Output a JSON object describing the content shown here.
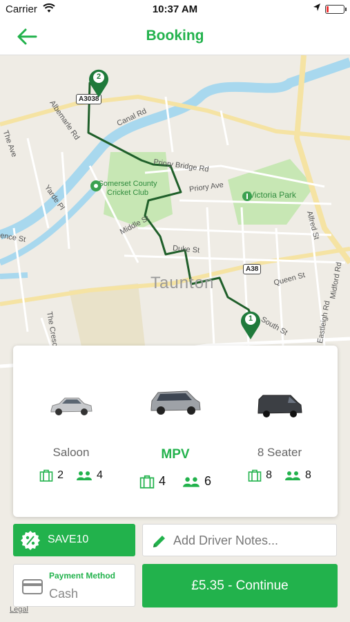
{
  "status_bar": {
    "carrier": "Carrier",
    "time": "10:37 AM"
  },
  "nav": {
    "title": "Booking",
    "back_icon": "arrow-left-icon"
  },
  "map": {
    "town": "Taunton",
    "labels": {
      "road_a3038": "A3038",
      "road_a38": "A38",
      "canal_rd": "Canal Rd",
      "albemarle_rd": "Albemarle Rd",
      "the_ave": "The Ave",
      "yarde_pl": "Yarde Pl",
      "priory_bridge_rd": "Priory Bridge Rd",
      "priory_ave": "Priory Ave",
      "middle_st": "Middle St",
      "duke_st": "Duke St",
      "queen_st": "Queen St",
      "south_st": "South St",
      "alfred_st": "Alfred St",
      "midford_rd": "Midford Rd",
      "eastleigh_rd": "Eastleigh Rd",
      "the_crescent": "The Cresc",
      "ence_st": "ence St"
    },
    "pois": {
      "cricket_club": "Somerset County Cricket Club",
      "victoria_park": "Victoria Park"
    },
    "markers": {
      "pickup": "1",
      "dropoff": "2"
    }
  },
  "vehicles": [
    {
      "name": "Saloon",
      "luggage": "2",
      "passengers": "4",
      "selected": false
    },
    {
      "name": "MPV",
      "luggage": "4",
      "passengers": "6",
      "selected": true
    },
    {
      "name": "8 Seater",
      "luggage": "8",
      "passengers": "8",
      "selected": false
    }
  ],
  "promo": {
    "code": "SAVE10",
    "icon": "percent-badge-icon"
  },
  "notes": {
    "placeholder": "Add Driver Notes...",
    "icon": "pencil-icon"
  },
  "payment": {
    "label": "Payment Method",
    "value": "Cash",
    "icon": "credit-card-icon"
  },
  "continue_button": {
    "label": "£5.35 - Continue"
  },
  "legal": "Legal",
  "colors": {
    "brand_green": "#22b24c",
    "route": "#1f5f2a",
    "water": "#a8d8ee",
    "park": "#c7e7b4"
  }
}
